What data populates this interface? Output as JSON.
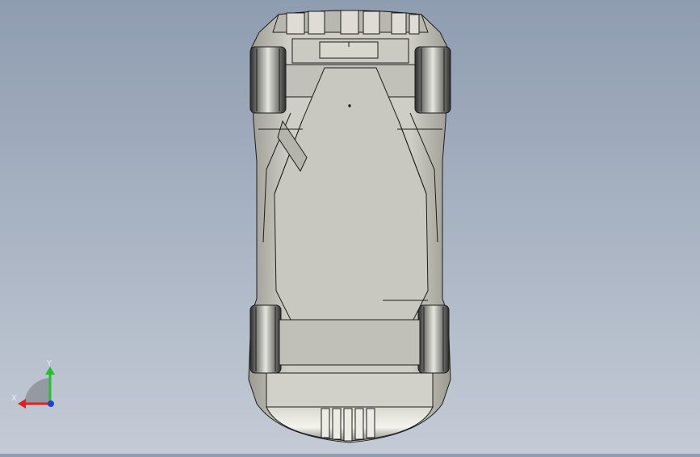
{
  "viewport": {
    "background_top": "#8f9db1",
    "background_bottom": "#c4cbd6",
    "model_fill": "#c7c6bd",
    "model_edge": "#1c1c1c",
    "tire_color": "#3e3e3e"
  },
  "triad": {
    "x_label": "X",
    "y_label": "Y",
    "x_color": "#e0201c",
    "y_color": "#22c22a",
    "z_color": "#1f3fd6"
  }
}
